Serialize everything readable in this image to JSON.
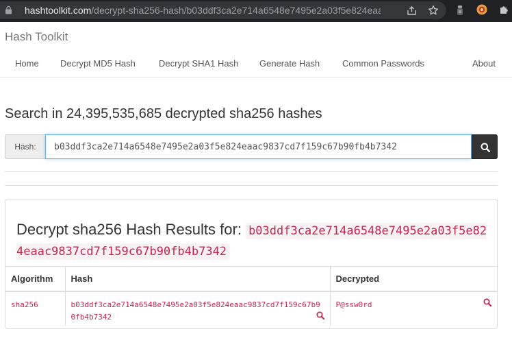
{
  "browser": {
    "url_host": "hashtoolkit.com",
    "url_path": "/decrypt-sha256-hash/b03ddf3ca2e714a6548e7495e2a03f5e824eaac9..."
  },
  "site": {
    "brand": "Hash Toolkit",
    "nav": [
      "Home",
      "Decrypt MD5 Hash",
      "Decrypt SHA1 Hash",
      "Generate Hash",
      "Common Passwords",
      "About"
    ]
  },
  "search": {
    "title": "Search in 24,395,535,685 decrypted sha256 hashes",
    "addon_label": "Hash:",
    "value": "b03ddf3ca2e714a6548e7495e2a03f5e824eaac9837cd7f159c67b90fb4b7342"
  },
  "result": {
    "heading": "Decrypt sha256 Hash Results for:",
    "hash": "b03ddf3ca2e714a6548e7495e2a03f5e824eaac9837cd7f159c67b90fb4b7342",
    "columns": [
      "Algorithm",
      "Hash",
      "Decrypted"
    ],
    "rows": [
      {
        "algorithm": "sha256",
        "hash": "b03ddf3ca2e714a6548e7495e2a03f5e824eaac9837cd7f159c67b90fb4b7342",
        "decrypted": "P@ssw0rd"
      }
    ]
  },
  "icons": {
    "address_lock": "lock-icon",
    "share": "share-icon",
    "bookmark": "star-icon",
    "extension_1": "extension-icon",
    "extension_2": "extension-icon",
    "extensions_menu": "puzzle-icon",
    "search_button": "search-icon",
    "row_search": "magnifier-icon"
  },
  "colors": {
    "code_text": "#c7254e",
    "code_bg": "#f9f2f4",
    "focus_border": "#66afe9",
    "search_button": "#333333",
    "browser_chrome": "#202124"
  }
}
